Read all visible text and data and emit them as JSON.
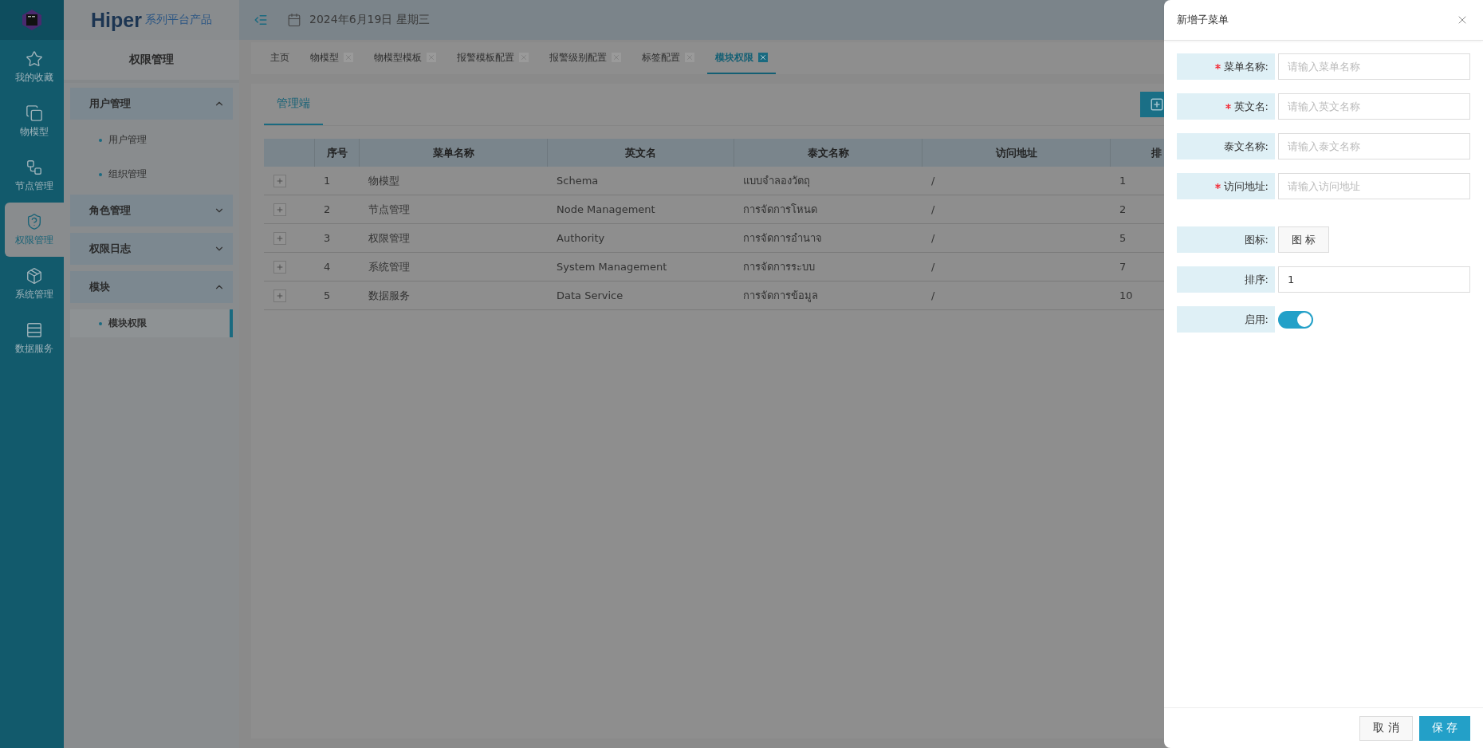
{
  "rail": {
    "items": [
      {
        "label": "我的收藏",
        "selected": false
      },
      {
        "label": "物模型",
        "selected": false
      },
      {
        "label": "节点管理",
        "selected": false
      },
      {
        "label": "权限管理",
        "selected": true
      },
      {
        "label": "系统管理",
        "selected": false
      },
      {
        "label": "数据服务",
        "selected": false
      }
    ]
  },
  "brand": {
    "name": "Hiper",
    "subtitle": "系列平台产品"
  },
  "sidebar": {
    "title": "权限管理",
    "groups": [
      {
        "label": "用户管理",
        "expanded": true,
        "children": [
          {
            "label": "用户管理",
            "selected": false
          },
          {
            "label": "组织管理",
            "selected": false
          }
        ]
      },
      {
        "label": "角色管理",
        "expanded": false
      },
      {
        "label": "权限日志",
        "expanded": false
      },
      {
        "label": "模块",
        "expanded": true,
        "children": [
          {
            "label": "模块权限",
            "selected": true
          }
        ]
      }
    ]
  },
  "topbar": {
    "date": "2024年6月19日 星期三"
  },
  "tabs": [
    {
      "label": "主页",
      "selected": false,
      "closable": false
    },
    {
      "label": "物模型",
      "selected": false,
      "closable": true
    },
    {
      "label": "物模型模板",
      "selected": false,
      "closable": true
    },
    {
      "label": "报警模板配置",
      "selected": false,
      "closable": true
    },
    {
      "label": "报警级别配置",
      "selected": false,
      "closable": true
    },
    {
      "label": "标签配置",
      "selected": false,
      "closable": true
    },
    {
      "label": "模块权限",
      "selected": true,
      "closable": true
    }
  ],
  "content": {
    "tabs": [
      {
        "label": "管理端",
        "selected": true
      }
    ],
    "table": {
      "columns": [
        "序号",
        "菜单名称",
        "英文名",
        "泰文名称",
        "访问地址",
        "排"
      ],
      "rows": [
        {
          "cells": [
            "1",
            "物模型",
            "Schema",
            "แบบจำลองวัตถุ",
            "/",
            "1"
          ]
        },
        {
          "cells": [
            "2",
            "节点管理",
            "Node Management",
            "การจัดการโหนด",
            "/",
            "2"
          ]
        },
        {
          "cells": [
            "3",
            "权限管理",
            "Authority",
            "การจัดการอำนาจ",
            "/",
            "5"
          ]
        },
        {
          "cells": [
            "4",
            "系统管理",
            "System Management",
            "การจัดการระบบ",
            "/",
            "7"
          ]
        },
        {
          "cells": [
            "5",
            "数据服务",
            "Data Service",
            "การจัดการข้อมูล",
            "/",
            "10"
          ]
        }
      ]
    }
  },
  "drawer": {
    "title": "新增子菜单",
    "fields": [
      {
        "kind": "text",
        "label": "菜单名称:",
        "required": true,
        "placeholder": "请输入菜单名称"
      },
      {
        "kind": "text",
        "label": "英文名:",
        "required": true,
        "placeholder": "请输入英文名称"
      },
      {
        "kind": "text",
        "label": "泰文名称:",
        "required": false,
        "placeholder": "请输入泰文名称"
      },
      {
        "kind": "text",
        "label": "访问地址:",
        "required": true,
        "placeholder": "请输入访问地址"
      },
      {
        "kind": "picker",
        "label": "图标:",
        "required": false,
        "button": "图 标"
      },
      {
        "kind": "text",
        "label": "排序:",
        "required": false,
        "value": "1"
      },
      {
        "kind": "switch",
        "label": "启用:",
        "required": false,
        "on": true
      }
    ],
    "buttons": [
      {
        "label": "取 消",
        "kind": "default"
      },
      {
        "label": "保 存",
        "kind": "primary"
      }
    ]
  }
}
